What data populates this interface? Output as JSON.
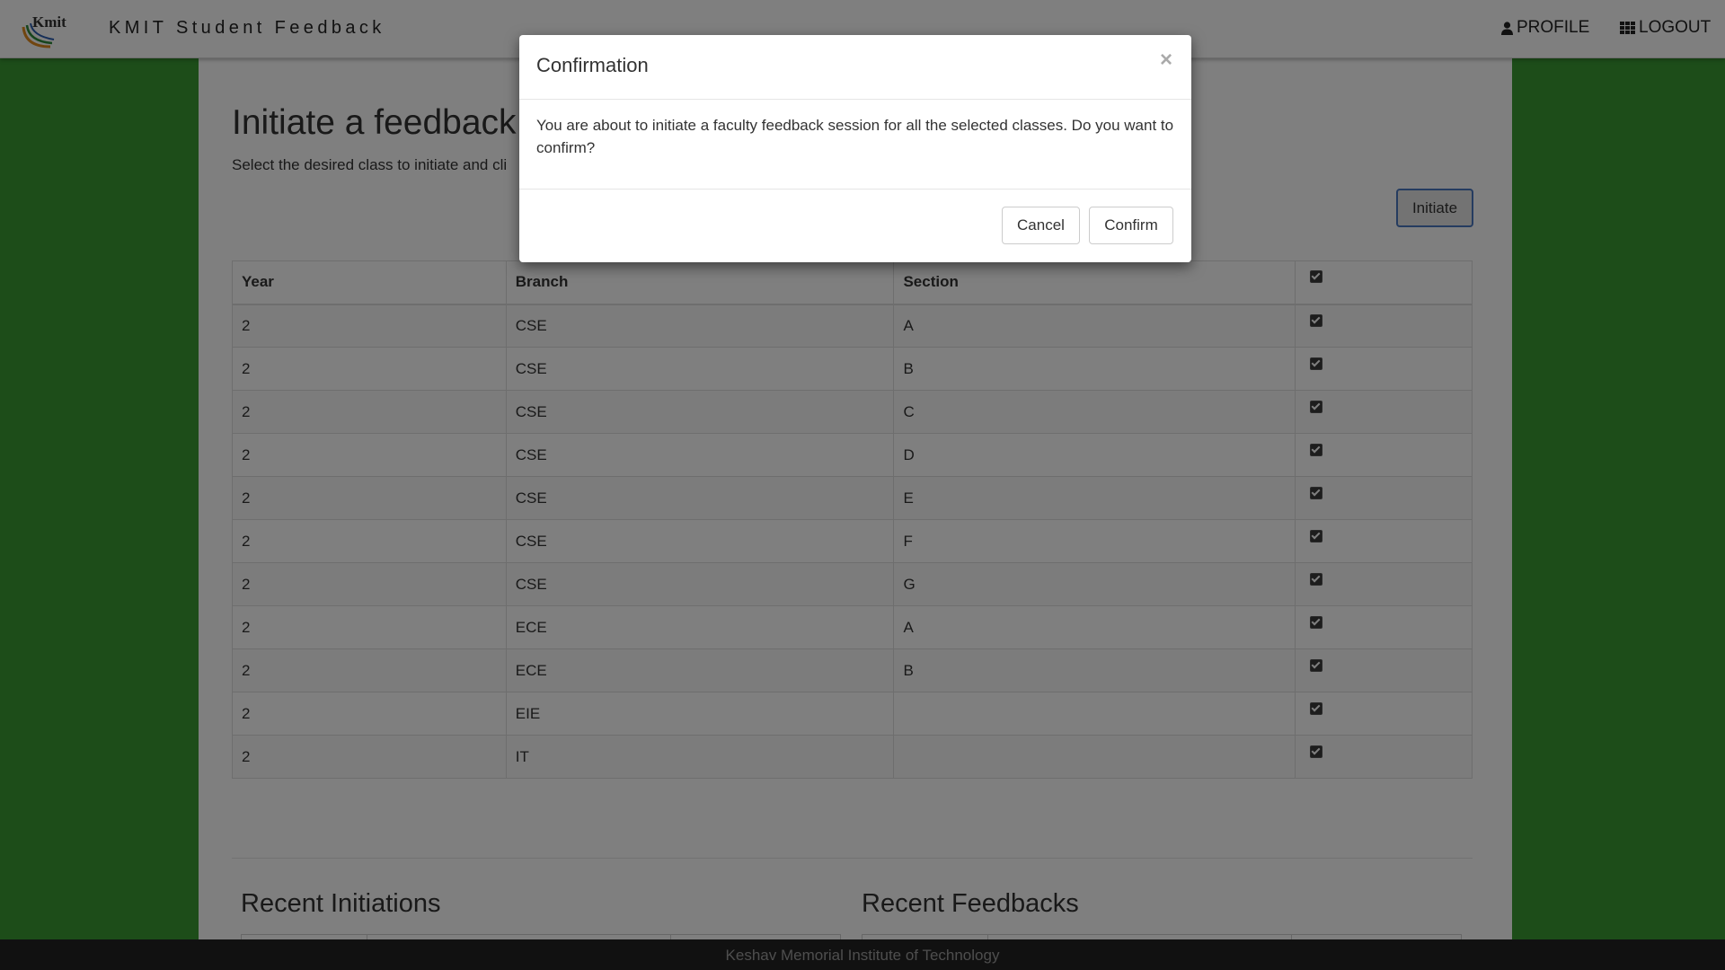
{
  "navbar": {
    "brand": "KMIT Student Feedback",
    "logo_text": "Kmit",
    "profile_label": "PROFILE",
    "logout_label": "LOGOUT",
    "profile_icon": "user-icon",
    "logout_icon": "grid-icon"
  },
  "page": {
    "title": "Initiate a feedback s",
    "subtitle": "Select the desired class to initiate and cli",
    "initiate_label": "Initiate"
  },
  "table": {
    "headers": [
      "Year",
      "Branch",
      "Section"
    ],
    "select_all_checked": true,
    "rows": [
      {
        "year": "2",
        "branch": "CSE",
        "section": "A",
        "checked": true
      },
      {
        "year": "2",
        "branch": "CSE",
        "section": "B",
        "checked": true
      },
      {
        "year": "2",
        "branch": "CSE",
        "section": "C",
        "checked": true
      },
      {
        "year": "2",
        "branch": "CSE",
        "section": "D",
        "checked": true
      },
      {
        "year": "2",
        "branch": "CSE",
        "section": "E",
        "checked": true
      },
      {
        "year": "2",
        "branch": "CSE",
        "section": "F",
        "checked": true
      },
      {
        "year": "2",
        "branch": "CSE",
        "section": "G",
        "checked": true
      },
      {
        "year": "2",
        "branch": "ECE",
        "section": "A",
        "checked": true
      },
      {
        "year": "2",
        "branch": "ECE",
        "section": "B",
        "checked": true
      },
      {
        "year": "2",
        "branch": "EIE",
        "section": "",
        "checked": true
      },
      {
        "year": "2",
        "branch": "IT",
        "section": "",
        "checked": true
      }
    ]
  },
  "recent": {
    "initiations_title": "Recent Initiations",
    "feedbacks_title": "Recent Feedbacks"
  },
  "footer": {
    "text": "Keshav Memorial Institute of Technology"
  },
  "modal": {
    "title": "Confirmation",
    "close_glyph": "×",
    "body": "You are about to initiate a faculty feedback session for all the selected classes. Do you want to confirm?",
    "cancel_label": "Cancel",
    "confirm_label": "Confirm"
  },
  "colors": {
    "page_background": "#3a9a33",
    "footer_background": "#222222",
    "initiate_border": "#4a78c0"
  }
}
